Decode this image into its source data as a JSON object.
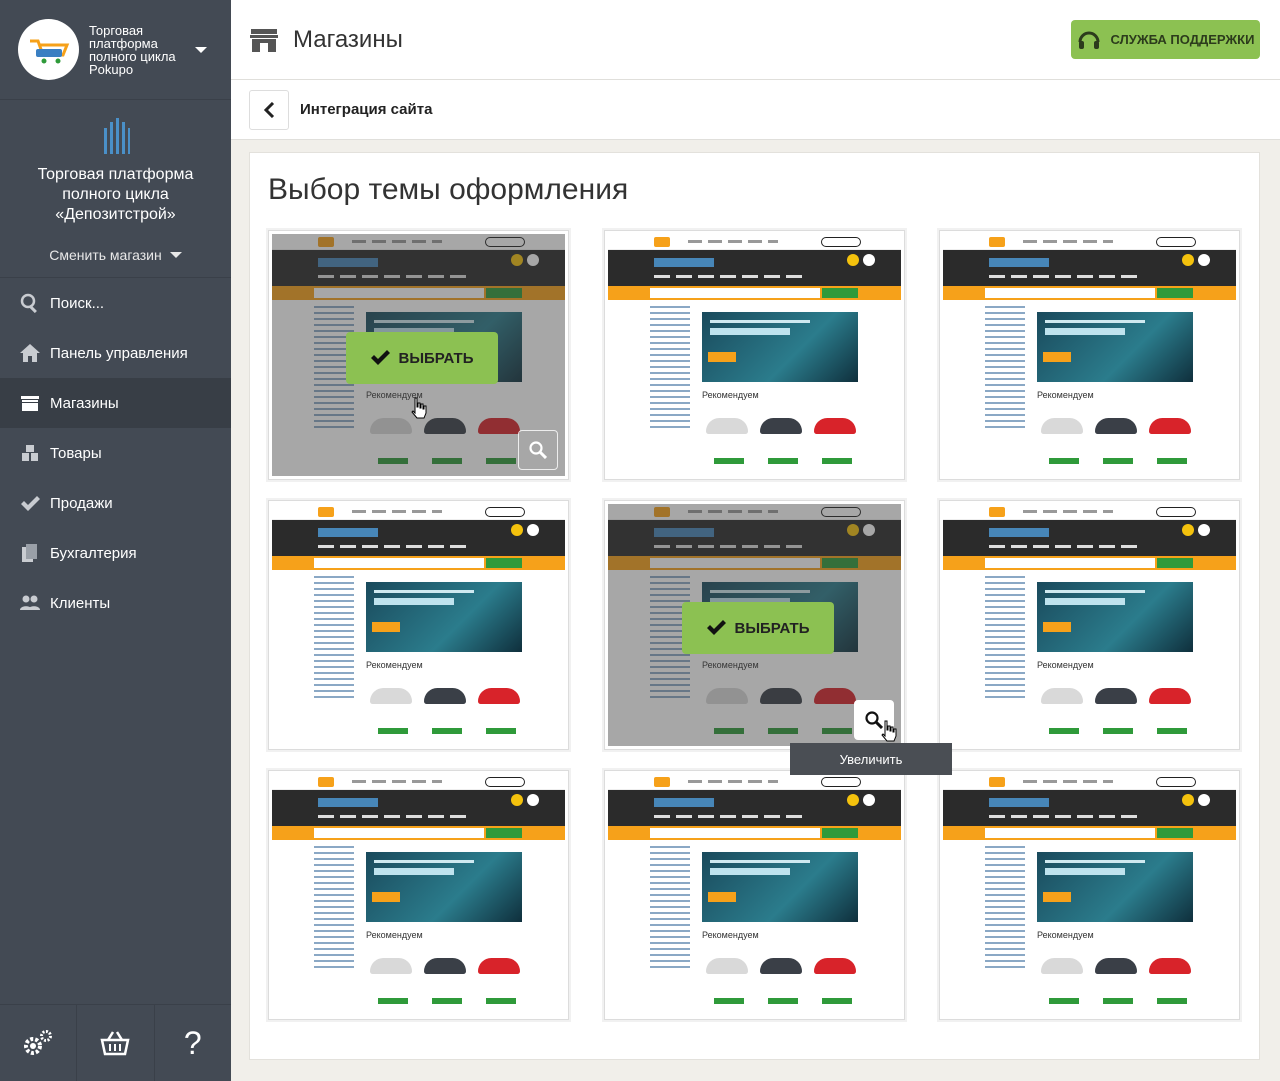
{
  "sidebar": {
    "org_name": "Торговая платформа полного цикла Pokupo",
    "store_name": "Торговая платформа полного цикла «Депозитстрой»",
    "switch_label": "Сменить магазин",
    "nav": [
      {
        "label": "Поиск...",
        "icon": "search-icon"
      },
      {
        "label": "Панель управления",
        "icon": "home-icon"
      },
      {
        "label": "Магазины",
        "icon": "store-icon",
        "active": true
      },
      {
        "label": "Товары",
        "icon": "boxes-icon"
      },
      {
        "label": "Продажи",
        "icon": "check-icon"
      },
      {
        "label": "Бухгалтерия",
        "icon": "documents-icon"
      },
      {
        "label": "Клиенты",
        "icon": "users-icon"
      }
    ],
    "bottom": [
      {
        "icon": "gears-icon"
      },
      {
        "icon": "basket-icon"
      },
      {
        "icon": "question-icon",
        "label": "?"
      }
    ]
  },
  "header": {
    "title": "Магазины",
    "support_label": "СЛУЖБА ПОДДЕРЖКИ"
  },
  "subheader": {
    "title": "Интеграция сайта"
  },
  "main": {
    "heading": "Выбор темы оформления",
    "select_label": "ВЫБРАТЬ",
    "zoom_tooltip": "Увеличить",
    "rec_label": "Рекомендуем",
    "themes": [
      {
        "hover": true,
        "zoom_active": false
      },
      {
        "hover": false
      },
      {
        "hover": false
      },
      {
        "hover": false
      },
      {
        "hover": true,
        "zoom_active": true
      },
      {
        "hover": false
      },
      {
        "hover": false
      },
      {
        "hover": false
      },
      {
        "hover": false
      }
    ]
  },
  "colors": {
    "sidebar": "#434a54",
    "accent_green": "#8cc152",
    "orange": "#f6a11a"
  }
}
